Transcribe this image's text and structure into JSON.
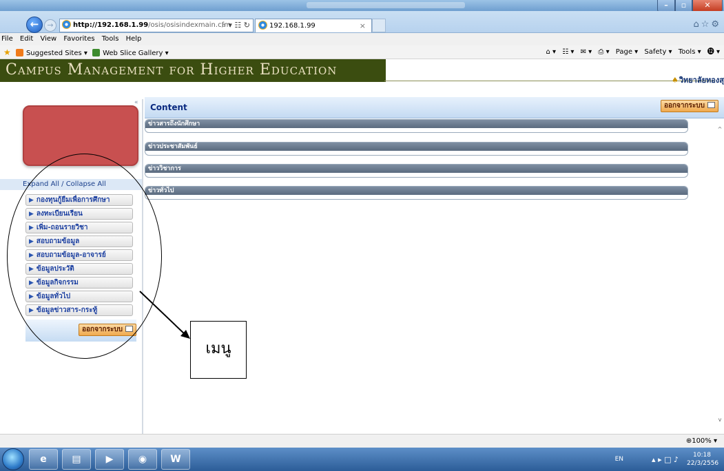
{
  "browser": {
    "address_host": "http://192.168.1.99",
    "address_path": "/osis/osisindexmain.cfm",
    "address_tools": "⌕ ▾ ☷ ↻",
    "tab_title": "192.168.1.99",
    "tab_close": "×",
    "toolbar_right_icons": "⌂☆⚙"
  },
  "menubar": [
    "File",
    "Edit",
    "View",
    "Favorites",
    "Tools",
    "Help"
  ],
  "favorites": {
    "suggested_sites": "Suggested Sites ▾",
    "web_slice_gallery": "Web Slice Gallery ▾",
    "right_tools": [
      "⌂ ▾",
      "☷ ▾",
      "✉ ▾",
      "⎙ ▾",
      "Page ▾",
      "Safety ▾",
      "Tools ▾",
      "⓬ ▾"
    ]
  },
  "page": {
    "banner_title": "Campus Management for Higher Education",
    "college_name": "วิทยาลัยทองสุ",
    "content_title": "Content",
    "logout_label": "ออกจากระบบ",
    "expand_collapse": "Expand All / Collapse All",
    "menu_items": [
      "กองทุนกู้ยืมเพื่อการศึกษา",
      "ลงทะเบียนเรียน",
      "เพิ่ม-ถอนรายวิชา",
      "สอบถามข้อมูล",
      "สอบถามข้อมูล-อาจารย์",
      "ข้อมูลประวัติ",
      "ข้อมูลกิจกรรม",
      "ข้อมูลทั่วไป",
      "ข้อมูลข่าวสาร-กระทู้"
    ],
    "news_sections": [
      "ข่าวสารถึงนักศึกษา",
      "ข่าวประชาสัมพันธ์",
      "ข่าววิชาการ",
      "ข่าวทั่วไป"
    ]
  },
  "annotation": {
    "label": "เมนู"
  },
  "statusbar": {
    "zoom": "⊕100% ▾"
  },
  "taskbar": {
    "lang": "EN",
    "tray_icons": "▴  ▸  □  ♪",
    "time": "10:18",
    "date": "22/3/2556"
  },
  "colors": {
    "banner_bg": "#3b4d10",
    "avatar": "#c85050",
    "menu_text": "#1b3fa0",
    "logout_bg": "#f0a94e"
  }
}
